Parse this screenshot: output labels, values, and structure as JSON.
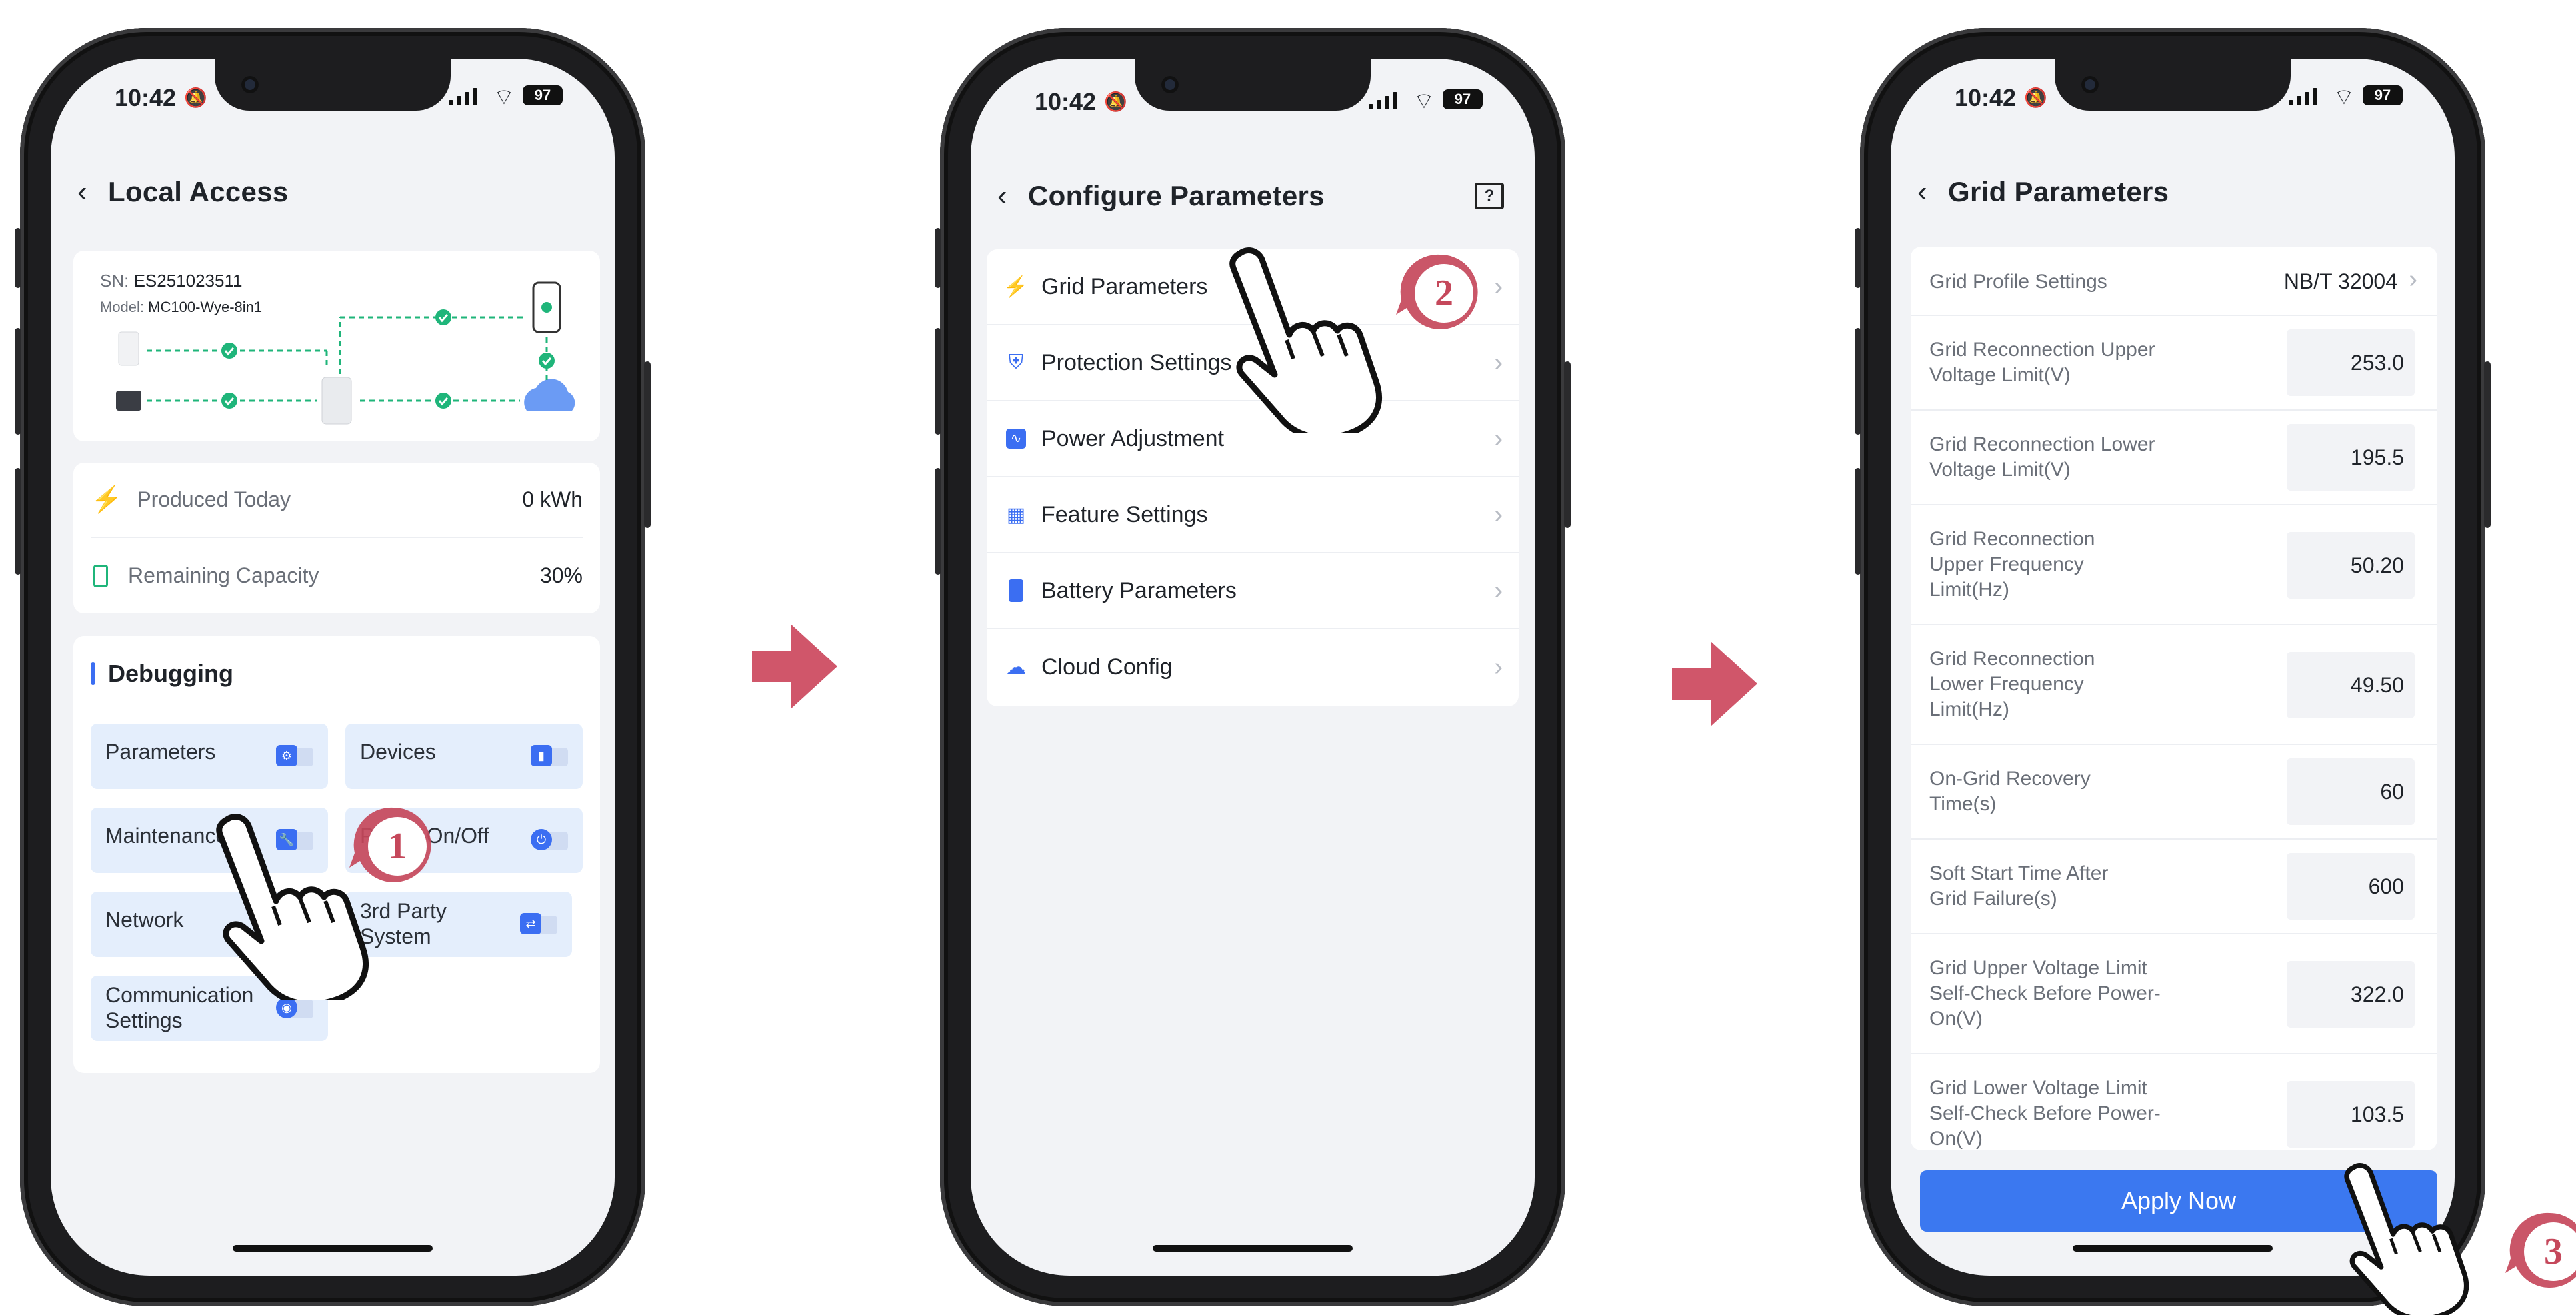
{
  "status": {
    "time": "10:42",
    "battery": "97"
  },
  "screen1": {
    "title": "Local Access",
    "device": {
      "sn_label": "SN:",
      "sn": "ES251023511",
      "model_label": "Model:",
      "model": "MC100-Wye-8in1"
    },
    "stats": [
      {
        "label": "Produced Today",
        "value": "0 kWh"
      },
      {
        "label": "Remaining Capacity",
        "value": "30%"
      }
    ],
    "section_title": "Debugging",
    "tiles": [
      {
        "label": "Parameters"
      },
      {
        "label": "Devices"
      },
      {
        "label": "Maintenance"
      },
      {
        "label": "Power On/Off"
      },
      {
        "label": "Network"
      },
      {
        "label": "3rd Party System"
      },
      {
        "label": "Communication Settings"
      }
    ],
    "step": "1"
  },
  "screen2": {
    "title": "Configure Parameters",
    "items": [
      {
        "label": "Grid Parameters",
        "icon": "tower-icon"
      },
      {
        "label": "Protection Settings",
        "icon": "shield-icon"
      },
      {
        "label": "Power Adjustment",
        "icon": "pulse-icon"
      },
      {
        "label": "Feature Settings",
        "icon": "grid-icon"
      },
      {
        "label": "Battery Parameters",
        "icon": "battery-icon"
      },
      {
        "label": "Cloud Config",
        "icon": "cloud-upload-icon"
      }
    ],
    "step": "2"
  },
  "screen3": {
    "title": "Grid Parameters",
    "profile": {
      "label": "Grid Profile Settings",
      "value": "NB/T 32004"
    },
    "params": [
      {
        "label": "Grid Reconnection Upper Voltage Limit(V)",
        "value": "253.0"
      },
      {
        "label": "Grid Reconnection Lower Voltage Limit(V)",
        "value": "195.5"
      },
      {
        "label": "Grid Reconnection Upper Frequency Limit(Hz)",
        "value": "50.20"
      },
      {
        "label": "Grid Reconnection Lower Frequency Limit(Hz)",
        "value": "49.50"
      },
      {
        "label": "On-Grid Recovery Time(s)",
        "value": "60"
      },
      {
        "label": "Soft Start Time After Grid Failure(s)",
        "value": "600"
      },
      {
        "label": "Grid Upper Voltage Limit Self-Check Before Power-On(V)",
        "value": "322.0"
      },
      {
        "label": "Grid Lower Voltage Limit Self-Check Before Power-On(V)",
        "value": "103.5"
      }
    ],
    "apply_label": "Apply Now",
    "step": "3"
  },
  "colors": {
    "accent": "#3b6ef2",
    "arrow": "#d0566a",
    "badge": "#c5485b",
    "green": "#1fb57a"
  }
}
